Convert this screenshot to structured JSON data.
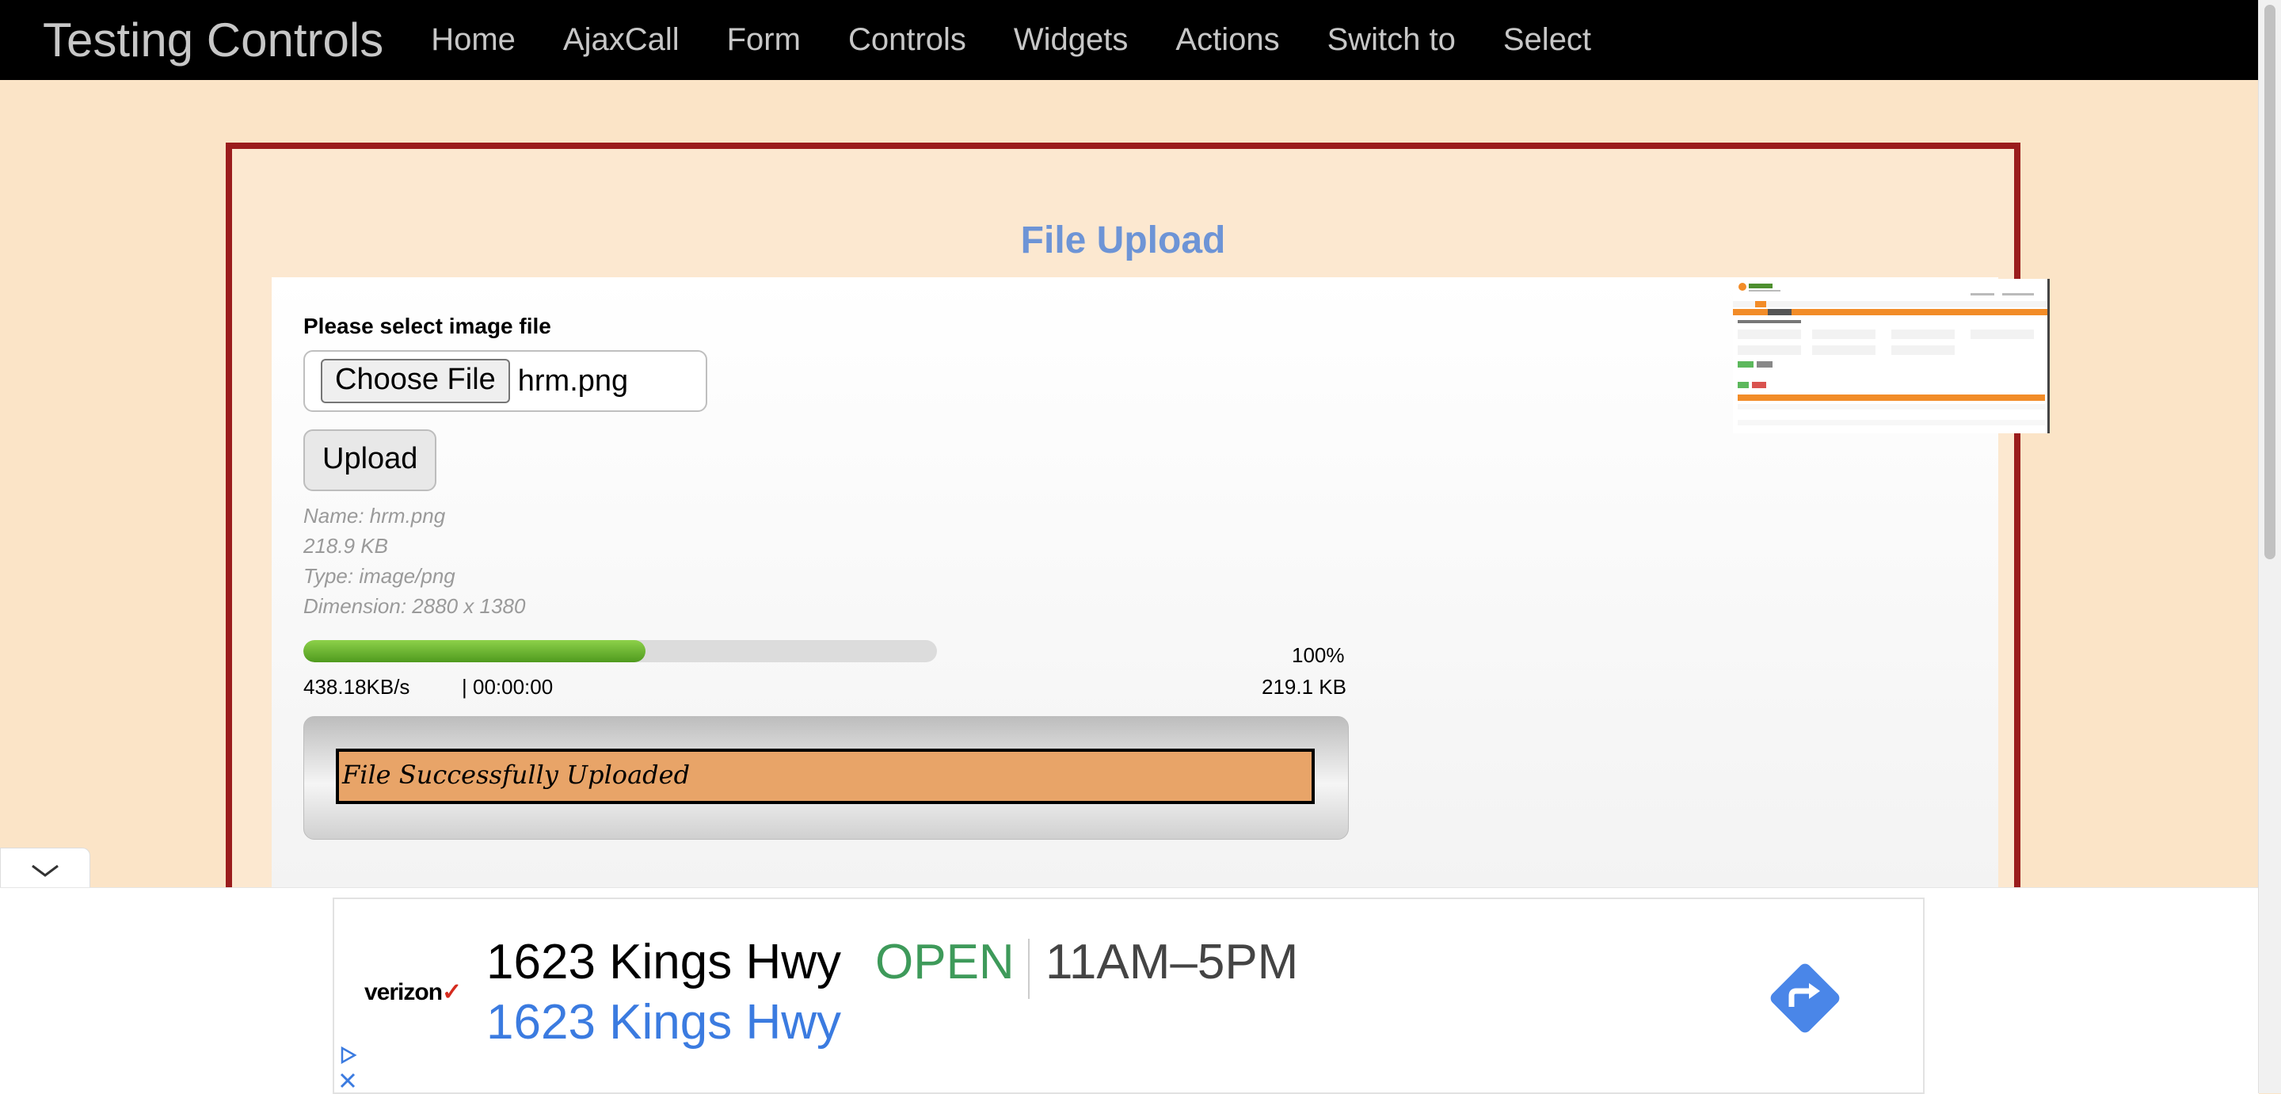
{
  "navbar": {
    "brand": "Testing Controls",
    "items": [
      "Home",
      "AjaxCall",
      "Form",
      "Controls",
      "Widgets",
      "Actions",
      "Switch to",
      "Select"
    ]
  },
  "page": {
    "title": "File Upload",
    "select_label": "Please select image file",
    "choose_file_label": "Choose File",
    "chosen_file": "hrm.png",
    "upload_label": "Upload",
    "file_info": {
      "name": "Name: hrm.png",
      "size": "218.9 KB",
      "type": "Type: image/png",
      "dimension": "Dimension: 2880 x 1380"
    },
    "progress": {
      "percent_text": "100%",
      "percent": 100,
      "speed": "438.18KB/s",
      "time": "| 00:00:00",
      "uploaded": "219.1 KB"
    },
    "success_message": "File Successfully Uploaded"
  },
  "ad": {
    "brand": "verizon",
    "address": "1623 Kings Hwy",
    "status": "OPEN",
    "hours": "11AM–5PM",
    "address_link": "1623 Kings Hwy"
  },
  "colors": {
    "navbar_bg": "#000000",
    "page_bg": "#fbe4c7",
    "frame_border": "#9b1c1c",
    "title": "#6d94d6",
    "progress_fill": "#5fae2a",
    "success_bg": "#e8a468",
    "ad_open": "#3e9a5a",
    "ad_link": "#3b7be0",
    "directions": "#4a86e8"
  }
}
